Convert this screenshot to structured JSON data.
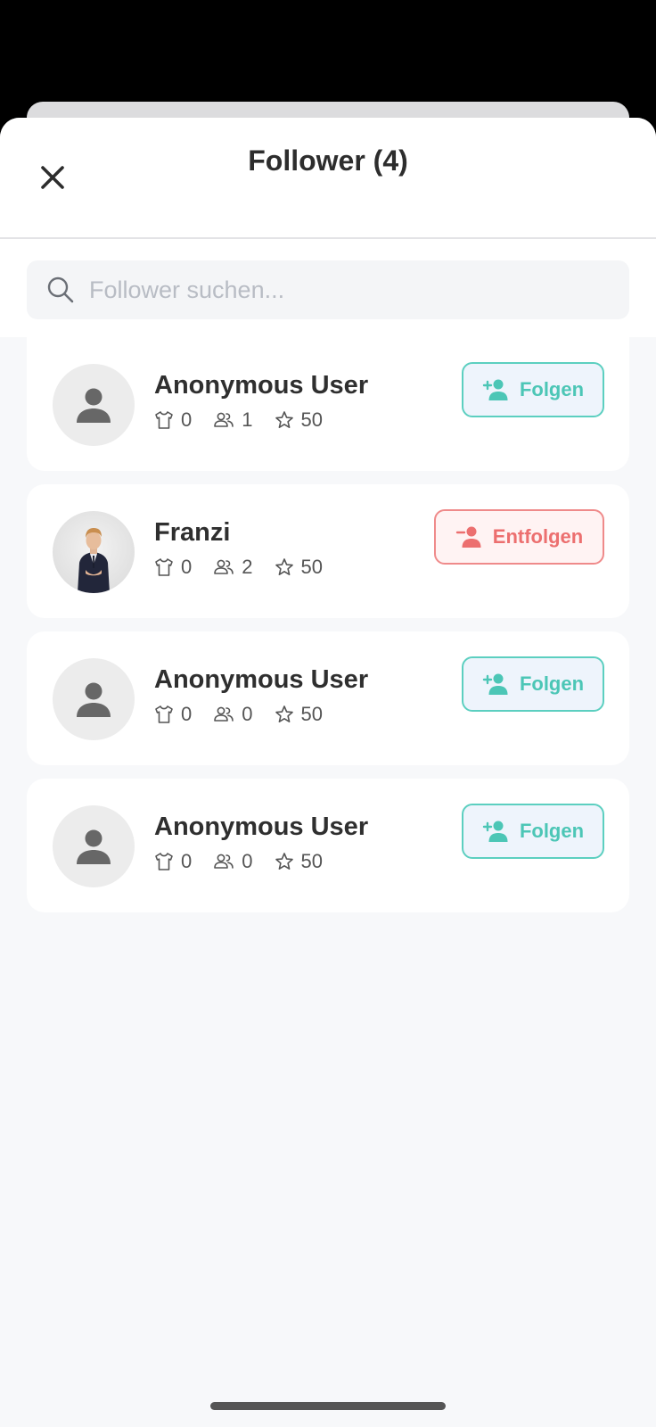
{
  "header": {
    "title": "Follower (4)",
    "close_icon": "close-icon"
  },
  "search": {
    "placeholder": "Follower suchen...",
    "value": ""
  },
  "colors": {
    "follow_accent": "#4cc6b6",
    "unfollow_accent": "#ec6f6f",
    "text_primary": "#2f2f2f"
  },
  "followers": [
    {
      "name": "Anonymous User",
      "outfits": "0",
      "followers": "1",
      "score": "50",
      "avatar": "default-person-icon",
      "action": "Folgen"
    },
    {
      "name": "Franzi",
      "outfits": "0",
      "followers": "2",
      "score": "50",
      "avatar": "profile-photo",
      "action": "Entfolgen"
    },
    {
      "name": "Anonymous User",
      "outfits": "0",
      "followers": "0",
      "score": "50",
      "avatar": "default-person-icon",
      "action": "Folgen"
    },
    {
      "name": "Anonymous User",
      "outfits": "0",
      "followers": "0",
      "score": "50",
      "avatar": "default-person-icon",
      "action": "Folgen"
    }
  ]
}
